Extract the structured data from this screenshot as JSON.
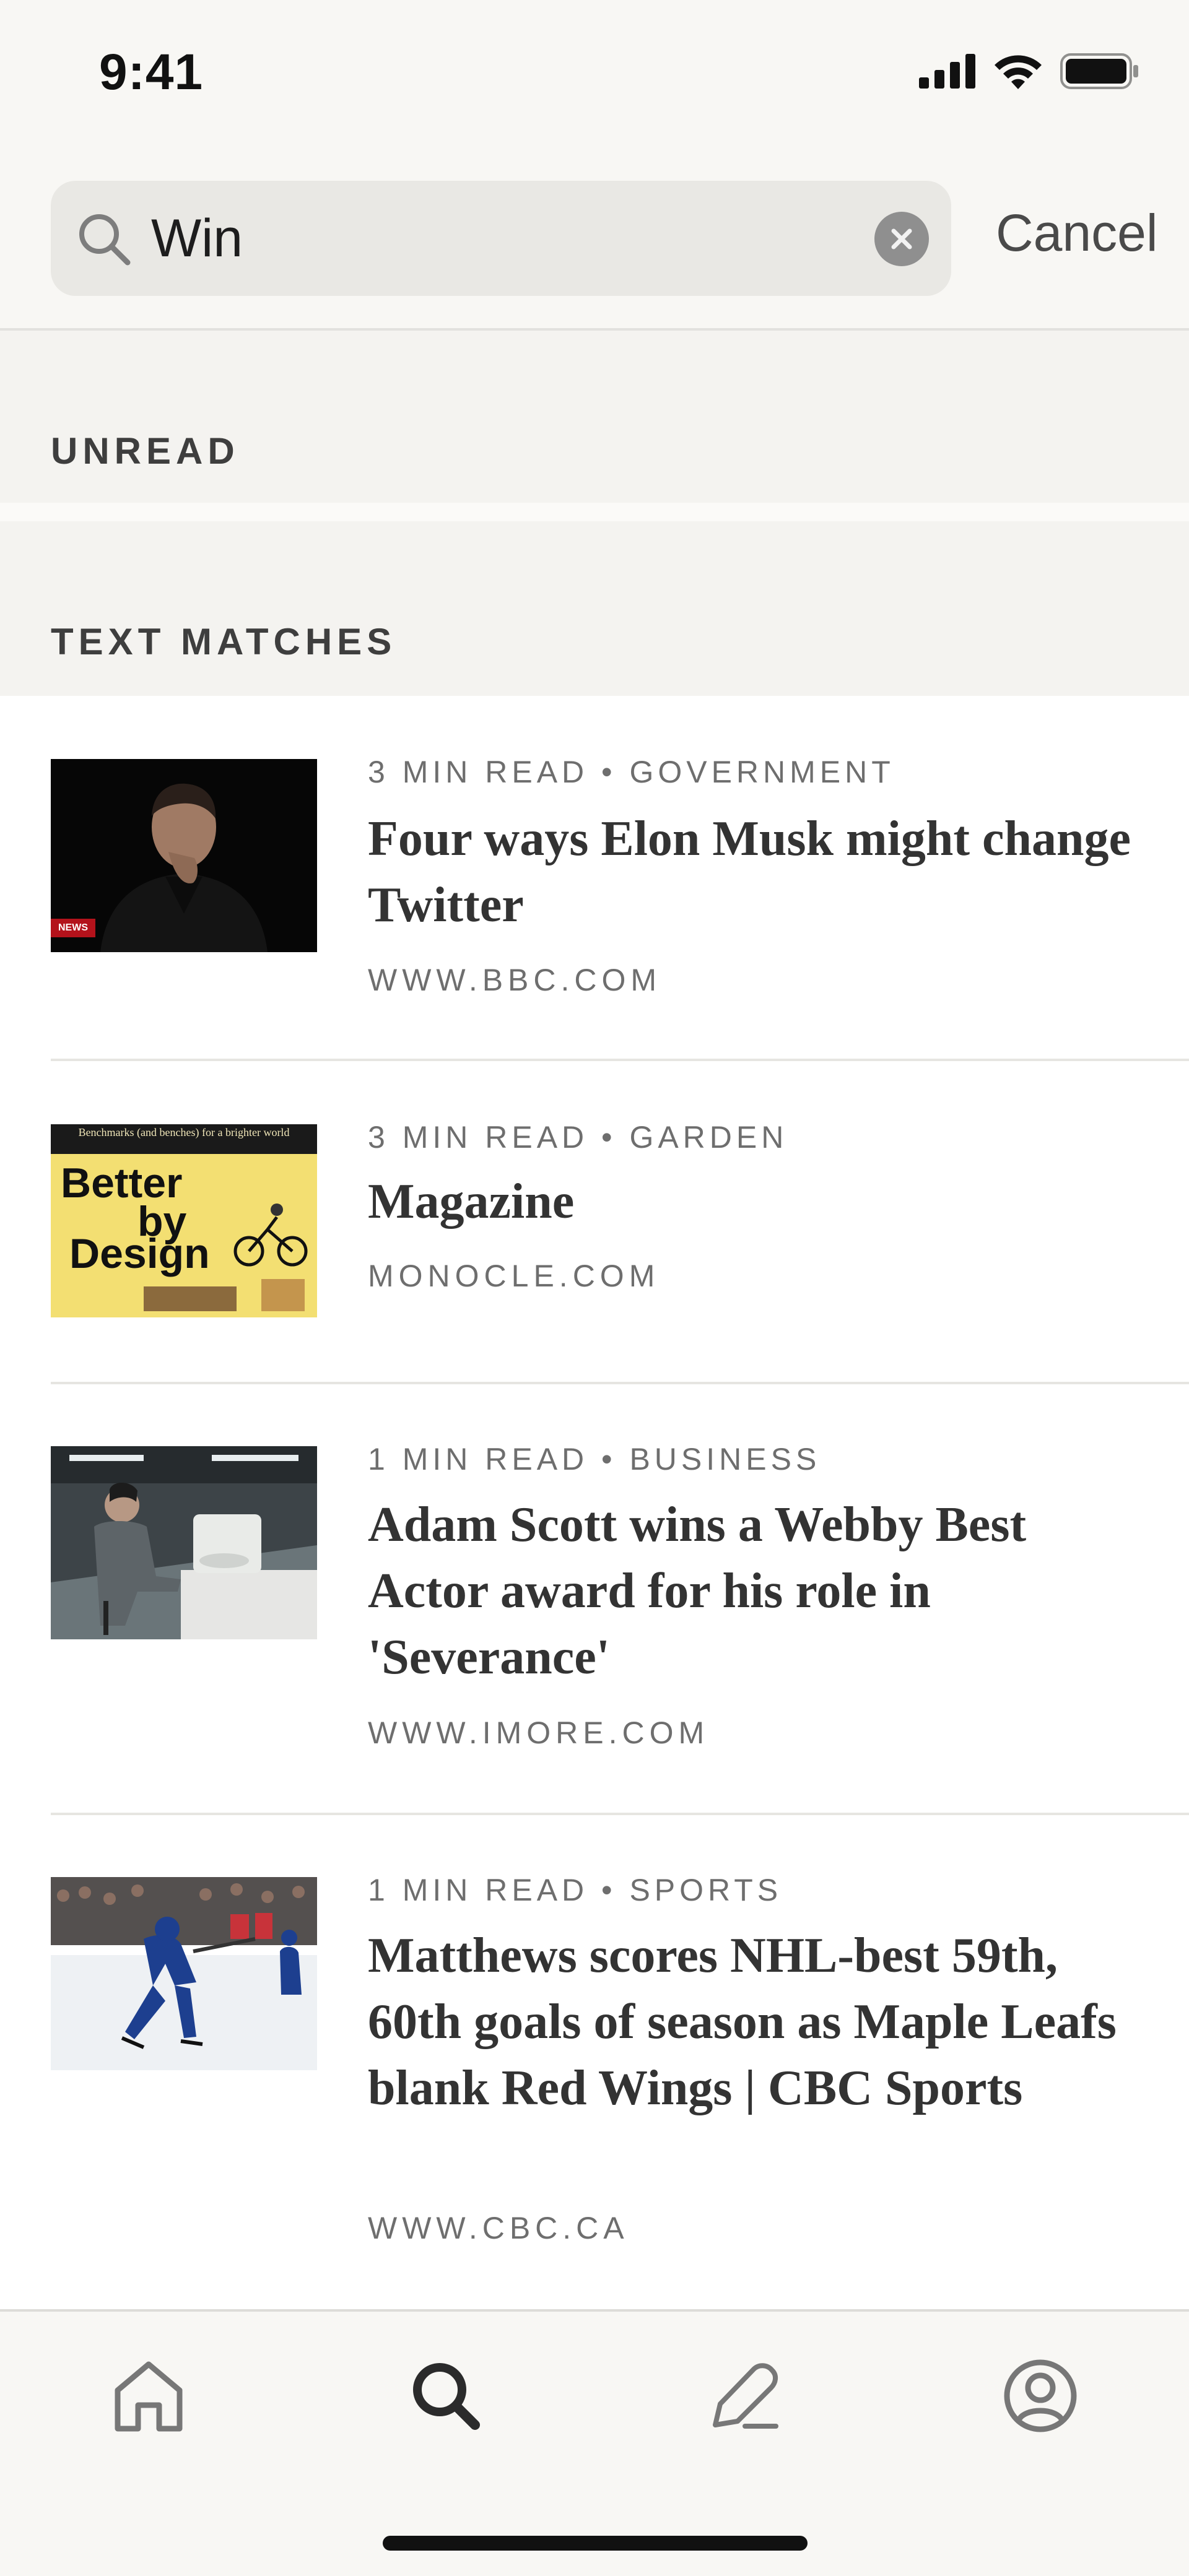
{
  "status_bar": {
    "time": "9:41"
  },
  "search": {
    "value": "Win",
    "cancel_label": "Cancel"
  },
  "sections": {
    "unread": "UNREAD",
    "text_matches": "TEXT MATCHES"
  },
  "results": [
    {
      "meta": "3 MIN READ • GOVERNMENT",
      "title": "Four ways Elon Musk might change Twitter",
      "source": "WWW.BBC.COM",
      "thumb_badge": "NEWS"
    },
    {
      "meta": "3 MIN READ • GARDEN",
      "title": "Magazine",
      "source": "MONOCLE.COM",
      "thumb_text": [
        "Benchmarks (and benches) for a brighter world",
        "Better",
        "by",
        "Design"
      ]
    },
    {
      "meta": "1 MIN READ • BUSINESS",
      "title": "Adam Scott wins a Webby Best Actor award for his role in 'Severance'",
      "source": "WWW.IMORE.COM"
    },
    {
      "meta": "1 MIN READ • SPORTS",
      "title": "Matthews scores NHL-best 59th, 60th goals of season as Maple Leafs blank Red Wings | CBC Sports",
      "source": "WWW.CBC.CA"
    }
  ],
  "tab_bar": {
    "items": [
      "home-icon",
      "search-icon",
      "write-icon",
      "profile-icon"
    ],
    "active": "search-icon"
  },
  "colors": {
    "background": "#f8f7f4",
    "section_bg": "#f4f3f0",
    "search_field": "#e9e8e4",
    "text_dark": "#333333",
    "text_meta": "#6e6e6e"
  }
}
